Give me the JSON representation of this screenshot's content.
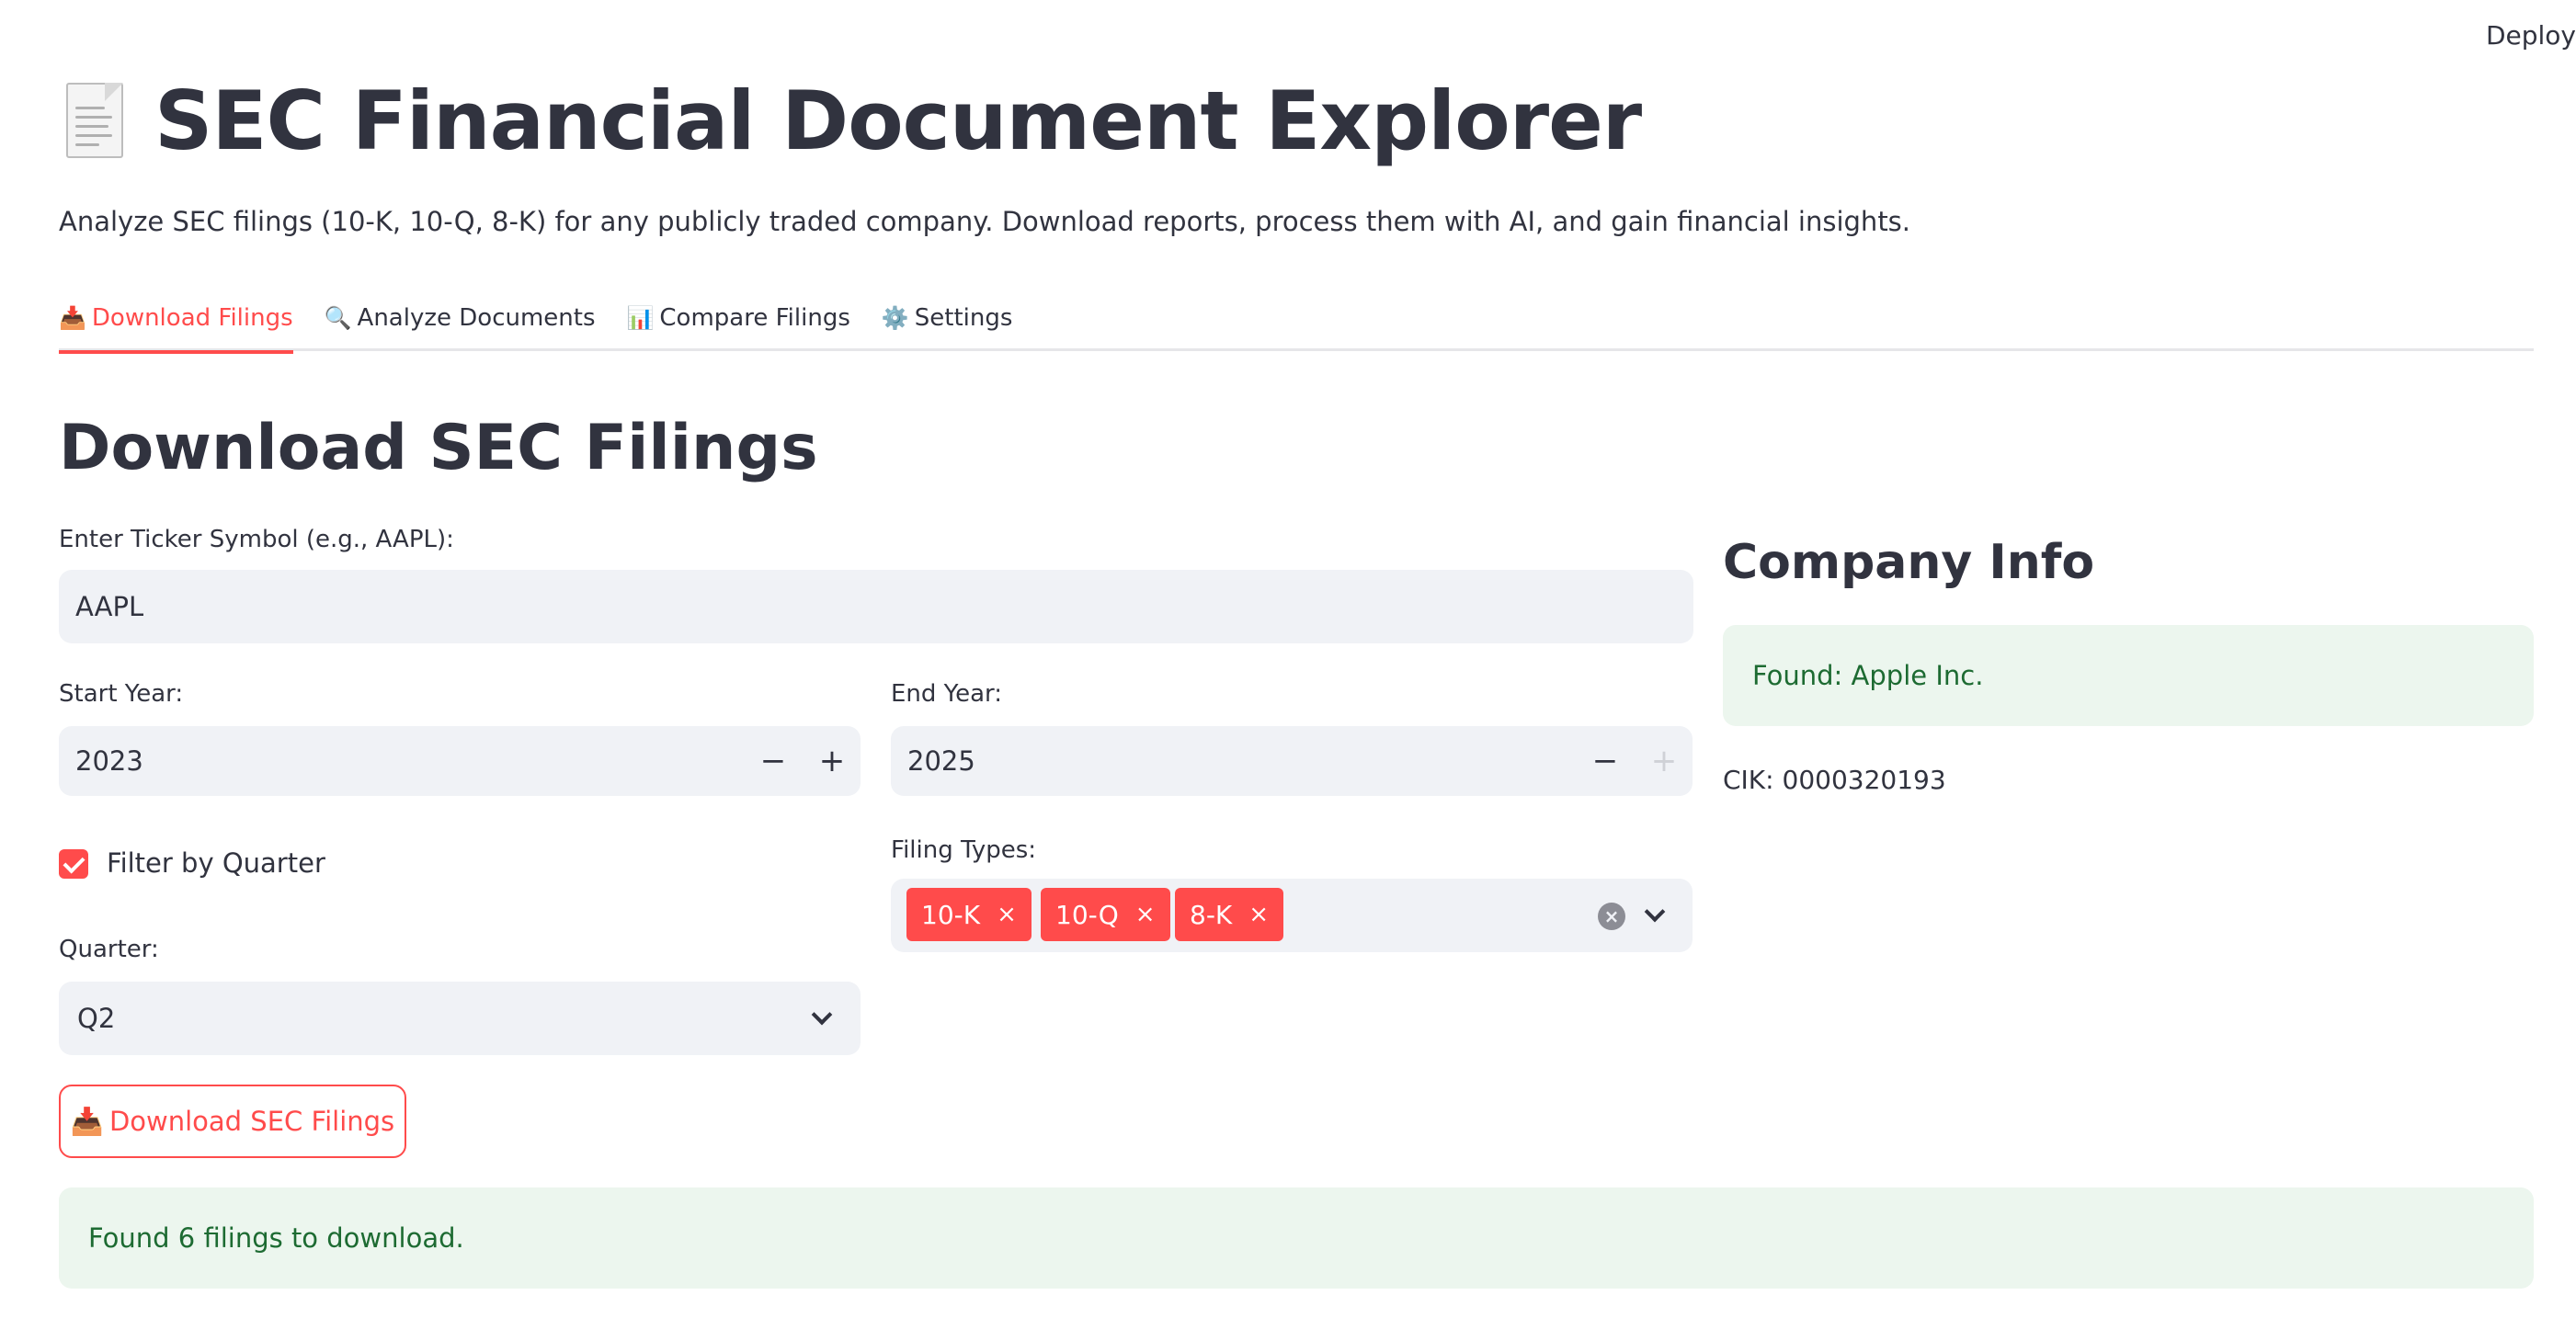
{
  "header": {
    "deploy_label": "Deploy"
  },
  "app": {
    "title": "SEC Financial Document Explorer",
    "subtitle": "Analyze SEC filings (10-K, 10-Q, 8-K) for any publicly traded company. Download reports, process them with AI, and gain financial insights."
  },
  "tabs": [
    {
      "icon": "📥",
      "label": "Download Filings",
      "active": true
    },
    {
      "icon": "🔍",
      "label": "Analyze Documents",
      "active": false
    },
    {
      "icon": "📊",
      "label": "Compare Filings",
      "active": false
    },
    {
      "icon": "⚙️",
      "label": "Settings",
      "active": false
    }
  ],
  "download": {
    "section_title": "Download SEC Filings",
    "ticker_label": "Enter Ticker Symbol (e.g., AAPL):",
    "ticker_value": "AAPL",
    "start_year_label": "Start Year:",
    "start_year_value": "2023",
    "end_year_label": "End Year:",
    "end_year_value": "2025",
    "filter_quarter_label": "Filter by Quarter",
    "filter_quarter_checked": true,
    "filing_types_label": "Filing Types:",
    "filing_types": [
      "10-K",
      "10-Q",
      "8-K"
    ],
    "quarter_label": "Quarter:",
    "quarter_value": "Q2",
    "button_icon": "📥",
    "button_label": "Download SEC Filings",
    "result_message": "Found 6 filings to download."
  },
  "company": {
    "title": "Company Info",
    "found_message": "Found: Apple Inc.",
    "cik": "CIK: 0000320193"
  },
  "colors": {
    "accent": "#ff4b4b",
    "success_bg": "#ecf6ee",
    "success_text": "#1d6b32",
    "input_bg": "#f0f2f6"
  },
  "icons": {
    "title_icon": "page-facing-up-icon",
    "stepper_minus": "minus-icon",
    "stepper_plus": "plus-icon"
  },
  "glyphs": {
    "minus": "−",
    "plus": "+",
    "x": "×"
  }
}
